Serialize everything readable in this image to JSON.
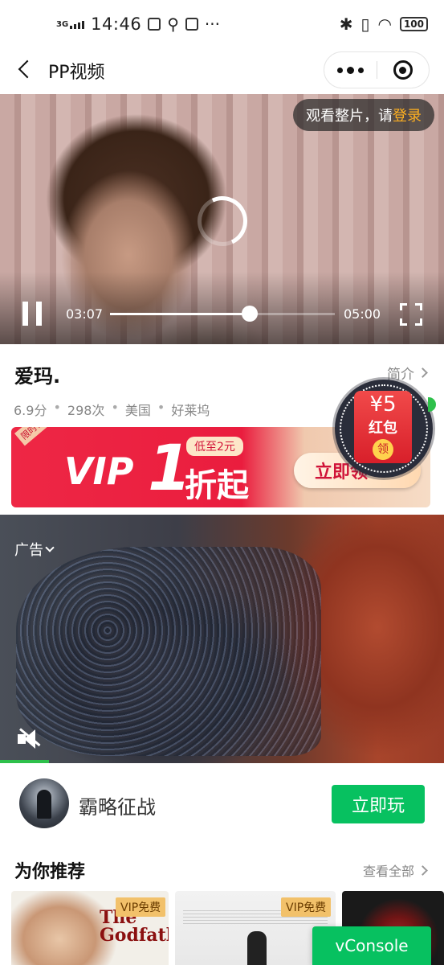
{
  "status_bar": {
    "network": "3G",
    "time": "14:46",
    "more": "···",
    "battery": "100"
  },
  "nav": {
    "title": "PP视频"
  },
  "player": {
    "login_prompt": "观看整片，请",
    "login_link": "登录",
    "current_time": "03:07",
    "total_time": "05:00",
    "progress": 0.62
  },
  "movie": {
    "title": "爱玛.",
    "intro_label": "简介",
    "score": "6.9分",
    "views": "298次",
    "region": "美国",
    "genre": "好莱坞",
    "meta_sep": "•"
  },
  "vip_banner": {
    "tag": "限时福利",
    "vip_text": "VIP",
    "discount_number": "1",
    "low_tag": "低至2元",
    "discount_suffix": "折起",
    "button_label": "立即领"
  },
  "red_packet": {
    "amount": "¥5",
    "label": "红包",
    "claim": "领"
  },
  "ad": {
    "label": "广告",
    "progress": 0.11
  },
  "game": {
    "name": "霸略征战",
    "play_label": "立即玩"
  },
  "recommend": {
    "title": "为你推荐",
    "see_all": "查看全部",
    "items": [
      {
        "badge": "VIP免费",
        "poster_text": "The Godfather"
      },
      {
        "badge": "VIP免费"
      },
      {
        "badge": ""
      }
    ]
  },
  "vconsole": {
    "label": "vConsole"
  },
  "colors": {
    "accent_green": "#07c160",
    "login_highlight": "#ffb020",
    "vip_red": "#ea1d3e"
  },
  "icons": [
    "back-arrow-icon",
    "more-dots-icon",
    "close-circle-icon",
    "pause-icon",
    "fullscreen-icon",
    "mute-icon",
    "chevron-right-icon",
    "chevron-down-icon"
  ]
}
